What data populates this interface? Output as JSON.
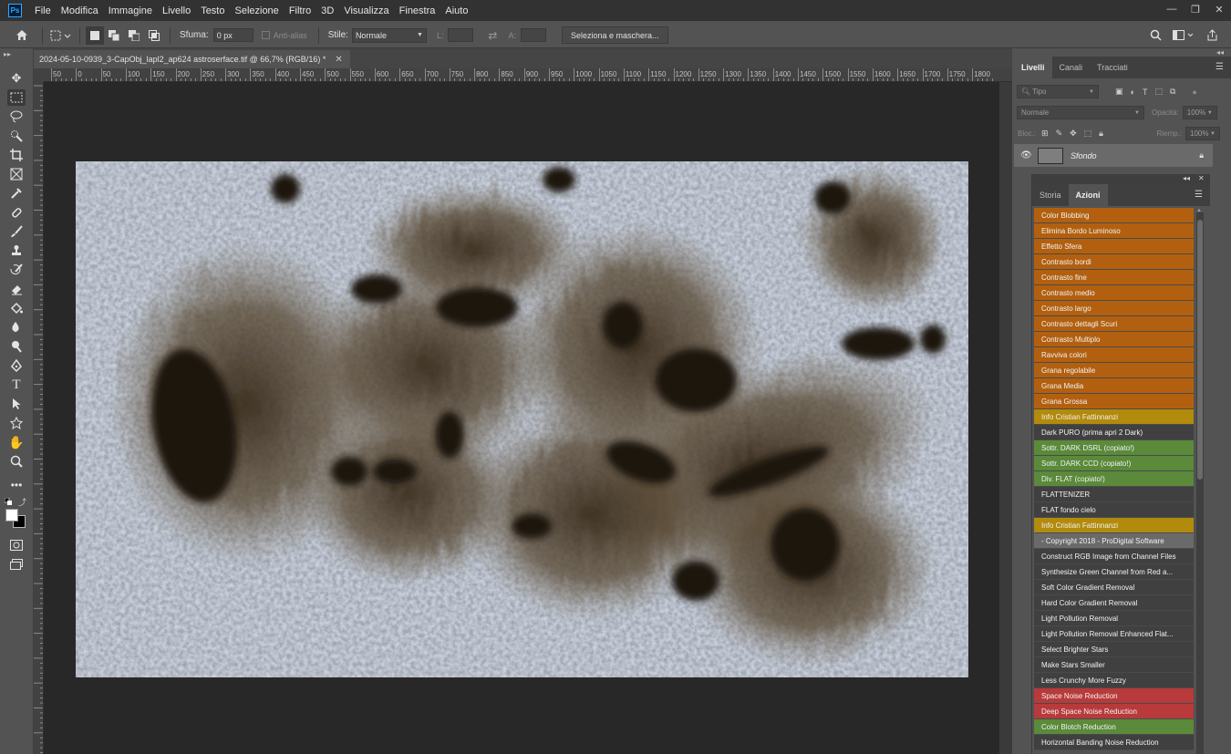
{
  "menubar": {
    "logo": "Ps",
    "items": [
      "File",
      "Modifica",
      "Immagine",
      "Livello",
      "Testo",
      "Selezione",
      "Filtro",
      "3D",
      "Visualizza",
      "Finestra",
      "Aiuto"
    ],
    "window_controls": [
      "—",
      "❐",
      "✕"
    ]
  },
  "options": {
    "feather_label": "Sfuma:",
    "feather_value": "0 px",
    "antialias_label": "Anti-alias",
    "style_label": "Stile:",
    "style_value": "Normale",
    "width_label": "L:",
    "height_label": "A:",
    "select_mask_label": "Seleziona e maschera..."
  },
  "document": {
    "tab_title": "2024-05-10-0939_3-CapObj_lapl2_ap624 astroserface.tif @ 66,7% (RGB/16) *",
    "close_glyph": "✕"
  },
  "ruler": {
    "labels": [
      "50",
      "0",
      "50",
      "100",
      "150",
      "200",
      "250",
      "300",
      "350",
      "400",
      "450",
      "500",
      "550",
      "600",
      "650",
      "700",
      "750",
      "800",
      "850",
      "900",
      "950",
      "1000",
      "1050",
      "1100",
      "1150",
      "1200",
      "1250",
      "1300",
      "1350",
      "1400",
      "1450",
      "1500",
      "1550",
      "1600",
      "1650",
      "1700",
      "1750",
      "1800"
    ]
  },
  "layers_panel": {
    "tabs": [
      "Livelli",
      "Canali",
      "Tracciati"
    ],
    "active_tab": "Livelli",
    "filter_label": "Tipo",
    "blend_mode": "Normale",
    "opacity_label": "Opacità:",
    "opacity_value": "100%",
    "lock_label": "Bloc.:",
    "fill_label": "Riemp.:",
    "fill_value": "100%",
    "layers": [
      {
        "name": "Sfondo"
      }
    ]
  },
  "actions_panel": {
    "tabs": [
      "Storia",
      "Azioni"
    ],
    "active_tab": "Azioni",
    "items": [
      {
        "label": "Color Blobbing",
        "color": "#b2600f"
      },
      {
        "label": "Elimina Bordo Luminoso",
        "color": "#b2600f"
      },
      {
        "label": "Effetto Sfera",
        "color": "#b2600f"
      },
      {
        "label": "Contrasto bordi",
        "color": "#b2600f"
      },
      {
        "label": "Contrasto fine",
        "color": "#b2600f"
      },
      {
        "label": "Contrasto medio",
        "color": "#b2600f"
      },
      {
        "label": "Contrasto largo",
        "color": "#b2600f"
      },
      {
        "label": "Contrasto dettagli Scuri",
        "color": "#b2600f"
      },
      {
        "label": "Contrasto Multiplo",
        "color": "#b2600f"
      },
      {
        "label": "Ravviva colori",
        "color": "#b2600f"
      },
      {
        "label": "Grana regolabile",
        "color": "#b2600f"
      },
      {
        "label": "Grana Media",
        "color": "#b2600f"
      },
      {
        "label": "Grana Grossa",
        "color": "#b2600f"
      },
      {
        "label": "Info Cristian Fattinnanzi",
        "color": "#b28a0c"
      },
      {
        "label": "Dark PURO (prima apri 2 Dark)",
        "color": "#404040"
      },
      {
        "label": "Sottr. DARK DSRL (copiato!)",
        "color": "#5a8a3a"
      },
      {
        "label": "Sottr. DARK CCD (copiato!)",
        "color": "#5a8a3a"
      },
      {
        "label": "Div. FLAT (copiato!)",
        "color": "#5a8a3a"
      },
      {
        "label": "FLATTENIZER",
        "color": "#404040"
      },
      {
        "label": "FLAT fondo cielo",
        "color": "#404040"
      },
      {
        "label": "Info Cristian Fattinnanzi",
        "color": "#b28a0c"
      },
      {
        "label": "- Copyright 2018 - ProDigital Software",
        "color": "#6a6a6a"
      },
      {
        "label": "Construct RGB Image from Channel Files",
        "color": "#404040"
      },
      {
        "label": "Synthesize Green Channel from Red a...",
        "color": "#404040"
      },
      {
        "label": "Soft Color Gradient Removal",
        "color": "#404040"
      },
      {
        "label": "Hard Color Gradient Removal",
        "color": "#404040"
      },
      {
        "label": "Light Pollution Removal",
        "color": "#404040"
      },
      {
        "label": "Light Pollution Removal Enhanced Flat...",
        "color": "#404040"
      },
      {
        "label": "Select Brighter Stars",
        "color": "#404040"
      },
      {
        "label": "Make Stars Smaller",
        "color": "#404040"
      },
      {
        "label": "Less Crunchy More Fuzzy",
        "color": "#404040"
      },
      {
        "label": "Space Noise Reduction",
        "color": "#b83a3a"
      },
      {
        "label": "Deep Space Noise Reduction",
        "color": "#b83a3a"
      },
      {
        "label": "Color Blotch Reduction",
        "color": "#5a8a3a"
      },
      {
        "label": "Horizontal Banding Noise Reduction",
        "color": "#404040"
      }
    ]
  }
}
